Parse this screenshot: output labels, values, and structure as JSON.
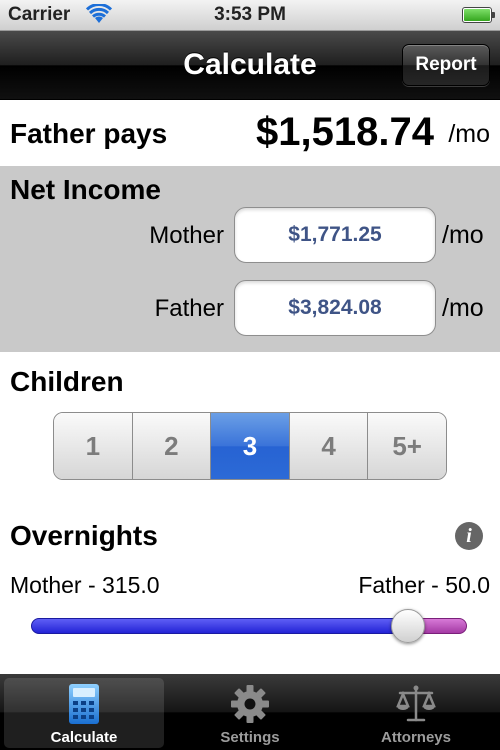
{
  "status_bar": {
    "carrier": "Carrier",
    "time": "3:53 PM",
    "battery_level": 1.0
  },
  "nav": {
    "title": "Calculate",
    "report_label": "Report"
  },
  "summary": {
    "label": "Father pays",
    "amount": "$1,518.74",
    "unit": "/mo"
  },
  "net_income": {
    "title": "Net Income",
    "mother": {
      "label": "Mother",
      "value": "$1,771.25",
      "unit": "/mo"
    },
    "father": {
      "label": "Father",
      "value": "$3,824.08",
      "unit": "/mo"
    }
  },
  "children": {
    "title": "Children",
    "options": [
      "1",
      "2",
      "3",
      "4",
      "5+"
    ],
    "selected": "3"
  },
  "overnights": {
    "title": "Overnights",
    "mother_label": "Mother - 315.0",
    "father_label": "Father - 50.0",
    "mother_nights": 315.0,
    "father_nights": 50.0
  },
  "tabs": [
    {
      "label": "Calculate",
      "icon": "calculator-icon",
      "active": true
    },
    {
      "label": "Settings",
      "icon": "gear-icon",
      "active": false
    },
    {
      "label": "Attorneys",
      "icon": "scales-icon",
      "active": false
    }
  ],
  "colors": {
    "accent": "#2c6ad6",
    "field_text": "#3f5486",
    "slider_left": "#2323d6",
    "slider_right": "#a43aa4"
  }
}
